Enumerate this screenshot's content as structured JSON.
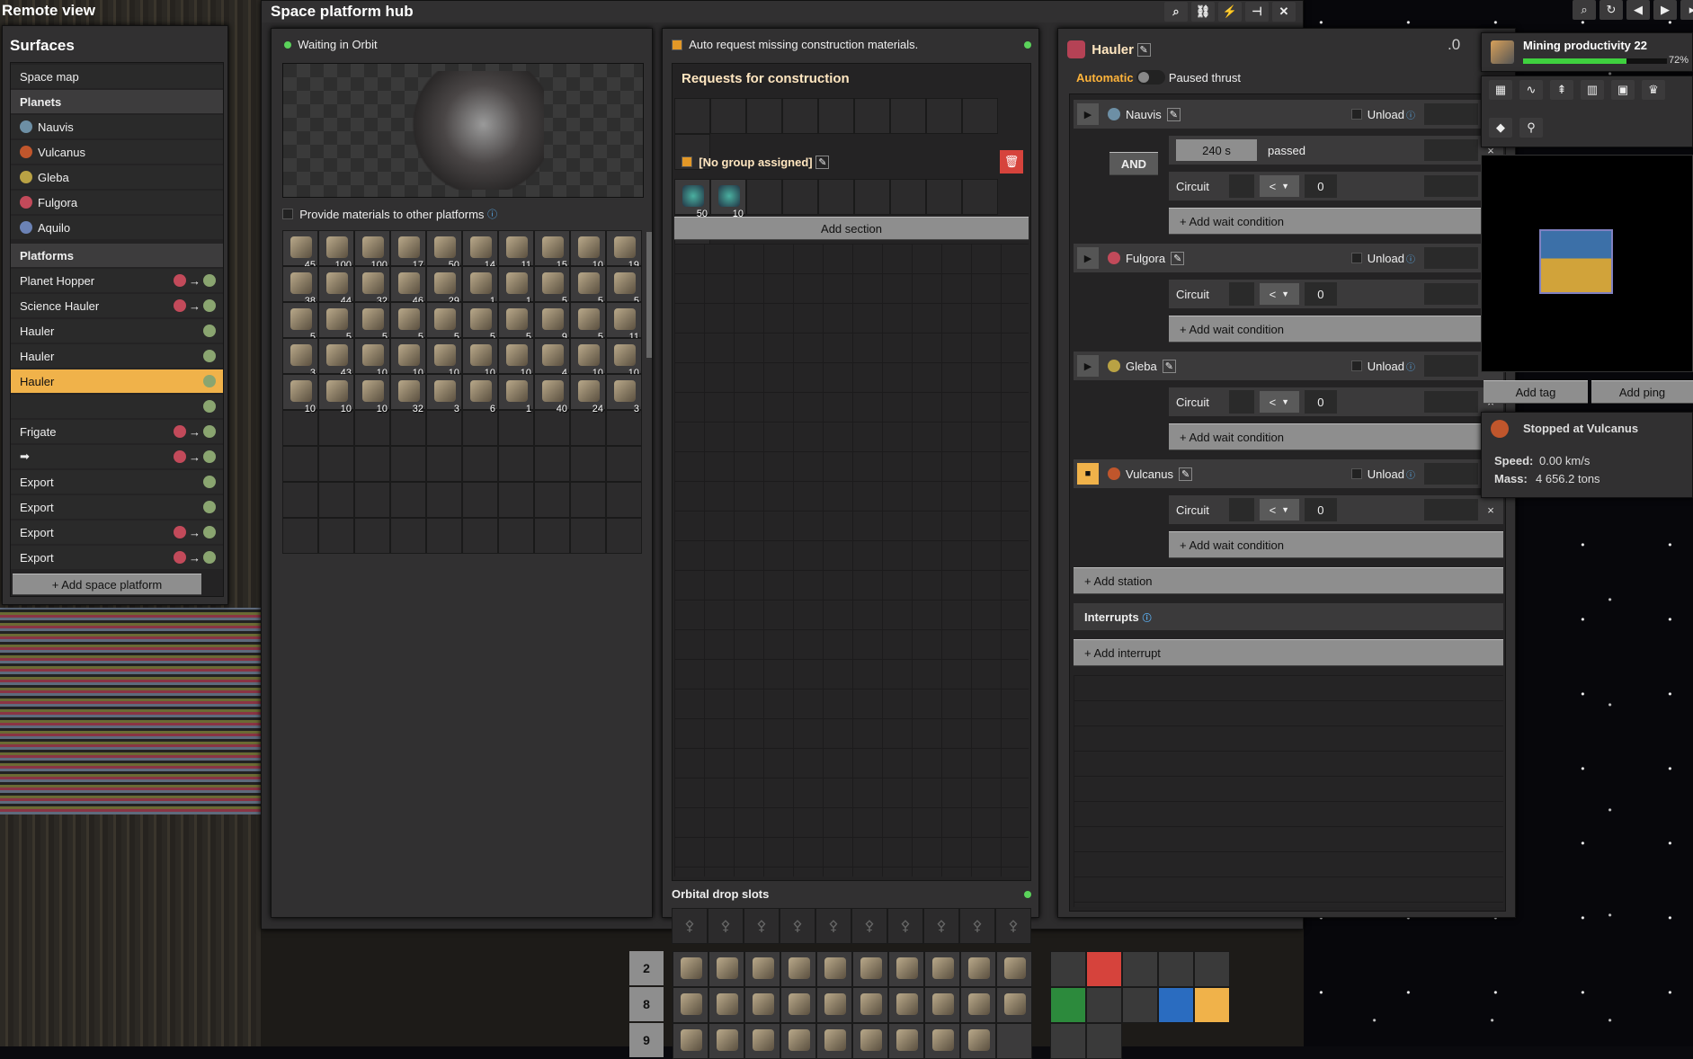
{
  "remote_view": {
    "title": "Remote view"
  },
  "surfaces": {
    "title": "Surfaces",
    "space_map": "Space map",
    "planets_header": "Planets",
    "planets": [
      {
        "name": "Nauvis",
        "color": "#6d8fa5"
      },
      {
        "name": "Vulcanus",
        "color": "#c0562c"
      },
      {
        "name": "Gleba",
        "color": "#b9a244"
      },
      {
        "name": "Fulgora",
        "color": "#c24a5a"
      },
      {
        "name": "Aquilo",
        "color": "#6b82b5"
      }
    ],
    "platforms_header": "Platforms",
    "platforms": [
      {
        "name": "Planet Hopper",
        "route": true
      },
      {
        "name": "Science Hauler",
        "route": true
      },
      {
        "name": "Hauler",
        "route": false
      },
      {
        "name": "Hauler",
        "route": false
      },
      {
        "name": "Hauler",
        "route": false,
        "selected": true
      },
      {
        "name": "",
        "route": false
      },
      {
        "name": "Frigate",
        "route": true
      },
      {
        "name": "➡",
        "route": true
      },
      {
        "name": "Export",
        "route": false
      },
      {
        "name": "Export",
        "route": false
      },
      {
        "name": "Export",
        "route": true
      },
      {
        "name": "Export",
        "route": true
      }
    ],
    "add_platform": "+ Add space platform"
  },
  "hub": {
    "title": "Space platform hub",
    "status": "Waiting in Orbit",
    "provide_label": "Provide materials to other platforms",
    "inventory": [
      "45",
      "100",
      "100",
      "17",
      "50",
      "14",
      "11",
      "15",
      "10",
      "19",
      "38",
      "44",
      "32",
      "46",
      "29",
      "1",
      "1",
      "5",
      "5",
      "5",
      "5",
      "5",
      "5",
      "5",
      "5",
      "5",
      "5",
      "9",
      "5",
      "11",
      "3",
      "43",
      "10",
      "10",
      "10",
      "10",
      "10",
      "4",
      "10",
      "10",
      "10",
      "10",
      "10",
      "32",
      "3",
      "6",
      "1",
      "40",
      "24",
      "3"
    ]
  },
  "construction": {
    "auto_request": "Auto request missing construction materials.",
    "requests_title": "Requests for construction",
    "group": "[No group assigned]",
    "group_items": [
      "50",
      "10"
    ],
    "add_section": "Add section",
    "orbital_title": "Orbital drop slots"
  },
  "schedule": {
    "title": "Hauler",
    "automatic": "Automatic",
    "paused": "Paused thrust",
    "stations": [
      {
        "name": "Nauvis",
        "color": "#6d8fa5",
        "unload": "Unload",
        "conditions": [
          {
            "type": "time",
            "value": "240 s",
            "label": "passed"
          },
          {
            "type": "circuit",
            "label": "Circuit",
            "op": "<",
            "value": "0"
          }
        ],
        "join": "AND"
      },
      {
        "name": "Fulgora",
        "color": "#c24a5a",
        "unload": "Unload",
        "conditions": [
          {
            "type": "circuit",
            "label": "Circuit",
            "op": "<",
            "value": "0"
          }
        ]
      },
      {
        "name": "Gleba",
        "color": "#b9a244",
        "unload": "Unload",
        "conditions": [
          {
            "type": "circuit",
            "label": "Circuit",
            "op": "<",
            "value": "0"
          }
        ]
      },
      {
        "name": "Vulcanus",
        "color": "#c0562c",
        "unload": "Unload",
        "conditions": [
          {
            "type": "circuit",
            "label": "Circuit",
            "op": "<",
            "value": "0"
          }
        ]
      }
    ],
    "add_wait": "+ Add wait condition",
    "add_station": "+ Add station",
    "interrupts": "Interrupts",
    "add_interrupt": "+ Add interrupt"
  },
  "research": {
    "name": "Mining productivity 22",
    "progress": 0.72,
    "progress_label": "72%"
  },
  "minimap": {
    "add_tag": "Add tag",
    "add_ping": "Add ping",
    "status": "Stopped at Vulcanus",
    "speed_label": "Speed:",
    "speed": "0.00 km/s",
    "mass_label": "Mass:",
    "mass": "4 656.2 tons",
    "partial": "0"
  },
  "quickbar": {
    "rows": [
      "2",
      "8",
      "9"
    ]
  }
}
